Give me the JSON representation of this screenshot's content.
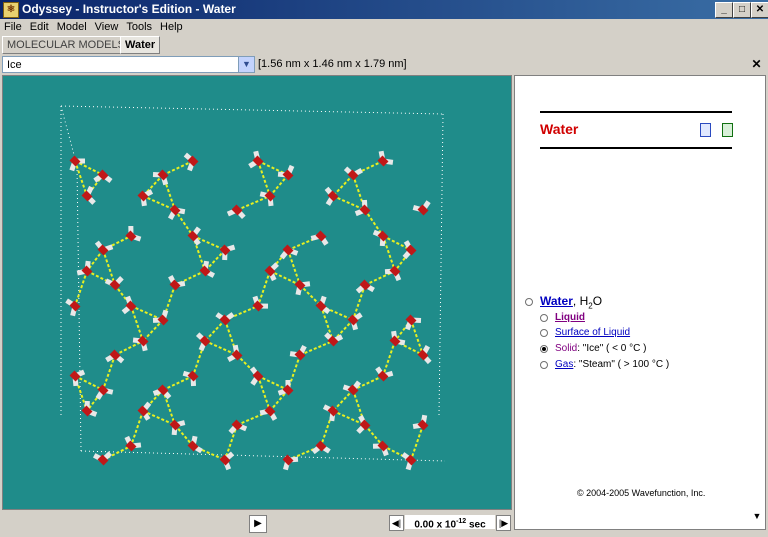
{
  "window": {
    "title": "Odyssey - Instructor's Edition - Water"
  },
  "menu": [
    "File",
    "Edit",
    "Model",
    "View",
    "Tools",
    "Help"
  ],
  "tabs": [
    {
      "label": "MOLECULAR MODELS"
    },
    {
      "label": "Water"
    }
  ],
  "toolbar": {
    "model_select": "Ice",
    "dimensions": "[1.56 nm x 1.46 nm x 1.79 nm]"
  },
  "panel": {
    "title": "Water",
    "heading_link": "Water",
    "formula": ", H",
    "formula_sub": "2",
    "formula_tail": "O",
    "options": [
      {
        "label": "Liquid",
        "suffix": ""
      },
      {
        "label": "Surface of Liquid",
        "suffix": ""
      },
      {
        "label": "Solid",
        "suffix": ": \"Ice\" ( < 0 °C )"
      },
      {
        "label": "Gas",
        "suffix": ": \"Steam\" ( > 100 °C )"
      }
    ],
    "copyright": "© 2004-2005 Wavefunction, Inc."
  },
  "player": {
    "time_value": "0.00 x 10",
    "time_exp": "-12",
    "time_unit": " sec"
  },
  "colors": {
    "viewer_bg": "#1f8c8a",
    "oxygen": "#c01818",
    "hydrogen": "#e8e8e8",
    "hbond": "#e8f020",
    "accent_title": "#d00000"
  },
  "icons": [
    "notes-icon",
    "refresh-icon",
    "play-icon",
    "step-back-icon",
    "step-forward-icon",
    "close-icon"
  ]
}
